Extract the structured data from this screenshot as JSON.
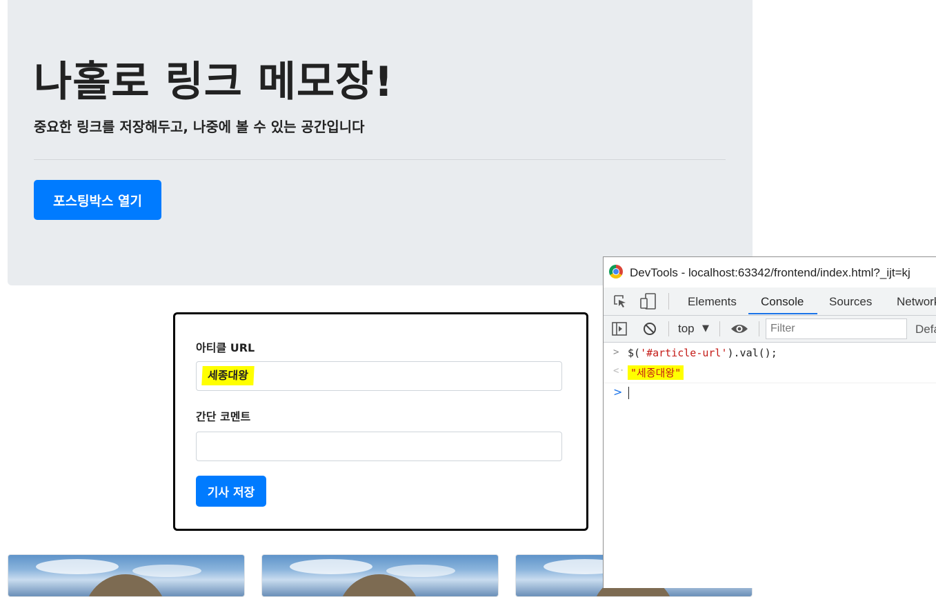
{
  "jumbotron": {
    "title": "나홀로 링크 메모장!",
    "lead": "중요한 링크를 저장해두고, 나중에 볼 수 있는 공간입니다",
    "open_button": "포스팅박스 열기"
  },
  "posting_box": {
    "url_label": "아티클 URL",
    "url_value": "세종대왕",
    "comment_label": "간단 코멘트",
    "comment_value": "",
    "save_button": "기사 저장"
  },
  "cards_count_visible": 3,
  "devtools": {
    "window_title": "DevTools - localhost:63342/frontend/index.html?_ijt=kj",
    "tabs": [
      "Elements",
      "Console",
      "Sources",
      "Network"
    ],
    "active_tab": "Console",
    "context": "top",
    "filter_placeholder": "Filter",
    "levels_label": "Default levels",
    "console": {
      "input_prefix": "$(",
      "input_string": "'#article-url'",
      "input_suffix": ").val();",
      "output": "\"세종대왕\""
    }
  },
  "colors": {
    "primary": "#007bff",
    "jumbotron_bg": "#e9ecef",
    "highlight": "#ffff00",
    "console_string": "#c41a16",
    "devtools_accent": "#1a73e8"
  }
}
